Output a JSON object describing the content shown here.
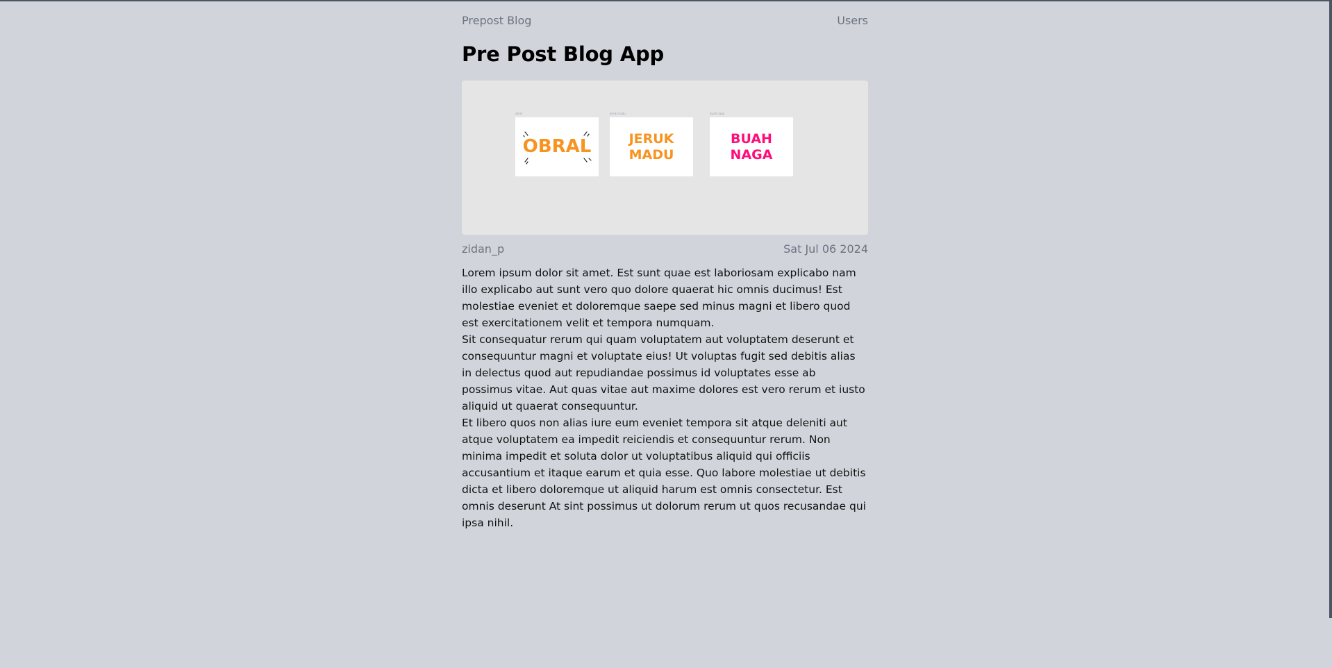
{
  "nav": {
    "brand": "Prepost Blog",
    "users_link": "Users"
  },
  "page": {
    "title": "Pre Post Blog App"
  },
  "hero": {
    "cards": [
      {
        "label": "obral",
        "lines": [
          "OBRAL"
        ],
        "color": "#f7931e"
      },
      {
        "label": "jeruk madu",
        "lines": [
          "JERUK",
          "MADU"
        ],
        "color": "#f7931e"
      },
      {
        "label": "buah naga",
        "lines": [
          "BUAH",
          "NAGA"
        ],
        "color": "#ff0d7a"
      }
    ]
  },
  "post": {
    "author": "zidan_p",
    "date": "Sat Jul 06 2024",
    "paragraphs": [
      "Lorem ipsum dolor sit amet. Est sunt quae est laboriosam explicabo nam illo explicabo aut sunt vero quo dolore quaerat hic omnis ducimus! Est molestiae eveniet et doloremque saepe sed minus magni et libero quod est exercitationem velit et tempora numquam.",
      "Sit consequatur rerum qui quam voluptatem aut voluptatem deserunt et consequuntur magni et voluptate eius! Ut voluptas fugit sed debitis alias in delectus quod aut repudiandae possimus id voluptates esse ab possimus vitae. Aut quas vitae aut maxime dolores est vero rerum et iusto aliquid ut quaerat consequuntur.",
      "Et libero quos non alias iure eum eveniet tempora sit atque deleniti aut atque voluptatem ea impedit reiciendis et consequuntur rerum. Non minima impedit et soluta dolor ut voluptatibus aliquid qui officiis accusantium et itaque earum et quia esse. Quo labore molestiae ut debitis dicta et libero doloremque ut aliquid harum est omnis consectetur. Est omnis deserunt At sint possimus ut dolorum rerum ut quos recusandae qui ipsa nihil."
    ]
  }
}
